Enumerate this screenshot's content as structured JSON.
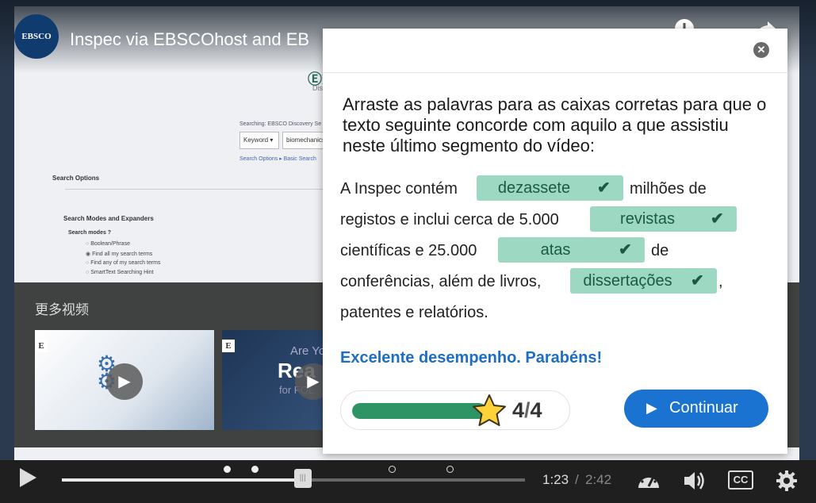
{
  "player": {
    "channel_logo": "EBSCO",
    "video_title": "Inspec via EBSCOhost and EB",
    "more_videos_title": "更多视频",
    "thumb2_line1": "Are Yo",
    "thumb2_line2": "Rea",
    "thumb2_line3": "for FOL",
    "thumb_badge": "E",
    "time_current": "1:23",
    "time_separator": "/",
    "time_total": "2:42",
    "cc_label": "CC",
    "progress": 0.52,
    "icons": [
      "play-icon",
      "speed-icon",
      "volume-icon",
      "cc-icon",
      "gear-icon",
      "info-icon",
      "share-icon",
      "star-icon",
      "check-icon",
      "close-icon"
    ]
  },
  "background_page": {
    "logo": "ⒺE",
    "logo_sub": "Discove",
    "searching_label": "Searching: EBSCO Discovery Se",
    "keyword_select": "Keyword ▾",
    "search_value": "biomechanics",
    "search_links": "Search Options ▸   Basic Search",
    "search_options_heading": "Search Options",
    "modes_heading": "Search Modes and Expanders",
    "modes_label": "Search modes ?",
    "modes": [
      "Boolean/Phrase",
      "Find all my search terms",
      "Find any of my search terms",
      "SmartText Searching Hint"
    ]
  },
  "quiz": {
    "instruction": "Arraste as palavras para as caixas corretas para que o texto seguinte concorde com aquilo a que assistiu neste último segmento do vídeo:",
    "line1_before": "A Inspec contém",
    "answer1": "dezassete",
    "line1_after": "milhões de",
    "line2_before": "registos e inclui cerca de 5.000",
    "answer2": "revistas",
    "line3_before": "científicas e 25.000",
    "answer3": "atas",
    "line3_after": "de",
    "line4_before": "conferências, além de livros,",
    "answer4": "dissertações",
    "line4_after": ",",
    "line5": "patentes e relatórios.",
    "feedback": "Excelente desempenho. Parabéns!",
    "score": "4",
    "score_sep": "/",
    "score_max": "4",
    "score_fraction": 1.0,
    "continue_label": "Continuar",
    "colors": {
      "correct_box": "#9dd9c2",
      "feedback": "#1d6ec5",
      "button": "#1a73d0",
      "score_bar": "#2e9466"
    }
  }
}
